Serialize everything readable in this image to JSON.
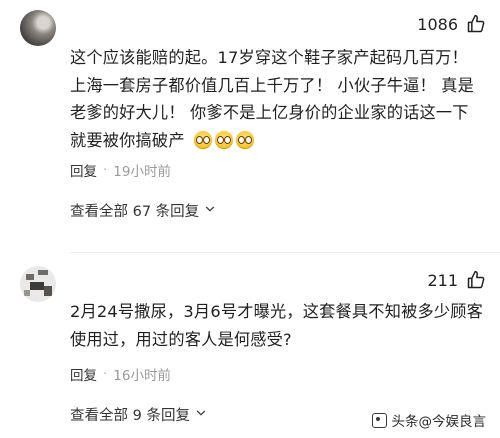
{
  "comments": [
    {
      "likes": "1086",
      "text_lines": [
        "这个应该能赔的起。17岁穿这个鞋子家产起码几百万！",
        "上海一套房子都价值几百上千万了！ 小伙子牛逼！ 真是",
        "老爹的好大儿！ 你爹不是上亿身价的企业家的话这一下",
        "就要被你搞破产"
      ],
      "emoji_count": 3,
      "reply_label": "回复",
      "separator": "·",
      "time": "19小时前",
      "view_replies": "查看全部 67 条回复"
    },
    {
      "likes": "211",
      "text_lines": [
        "2月24号撒尿，3月6号才曝光，这套餐具不知被多少顾客",
        "使用过，用过的客人是何感受?"
      ],
      "reply_label": "回复",
      "separator": "·",
      "time": "16小时前",
      "view_replies": "查看全部 9 条回复"
    }
  ],
  "watermark": "头条@今娱良言",
  "icons": {
    "like": "thumbs-up-icon",
    "expand": "chevron-down-icon",
    "emoji": "laughing-emoji-icon",
    "logo": "toutiao-logo-icon"
  }
}
